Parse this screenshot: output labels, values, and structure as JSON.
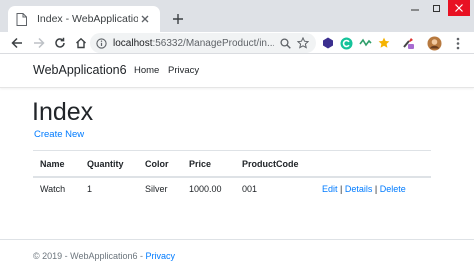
{
  "browser": {
    "tab_title": "Index - WebApplication6",
    "url_host": "localhost",
    "url_rest": ":56332/ManageProduct/in..."
  },
  "site": {
    "brand": "WebApplication6",
    "nav": [
      "Home",
      "Privacy"
    ]
  },
  "main": {
    "heading": "Index",
    "create_link": "Create New",
    "table": {
      "headers": [
        "Name",
        "Quantity",
        "Color",
        "Price",
        "ProductCode"
      ],
      "rows": [
        {
          "cells": [
            "Watch",
            "1",
            "Silver",
            "1000.00",
            "001"
          ]
        }
      ],
      "actions": [
        "Edit",
        "Details",
        "Delete"
      ],
      "action_separator": "|"
    }
  },
  "footer": {
    "text": "© 2019 - WebApplication6 - ",
    "link": "Privacy"
  },
  "colors": {
    "link": "#007bff",
    "tabstrip": "#dee1e6",
    "text": "#212529",
    "muted": "#6c757d"
  },
  "icons": [
    "document-favicon-icon",
    "close-icon",
    "plus-icon",
    "back-arrow-icon",
    "forward-arrow-icon",
    "reload-icon",
    "info-icon",
    "zoom-icon",
    "star-icon",
    "extension-icon",
    "avatar",
    "more-menu-icon"
  ]
}
